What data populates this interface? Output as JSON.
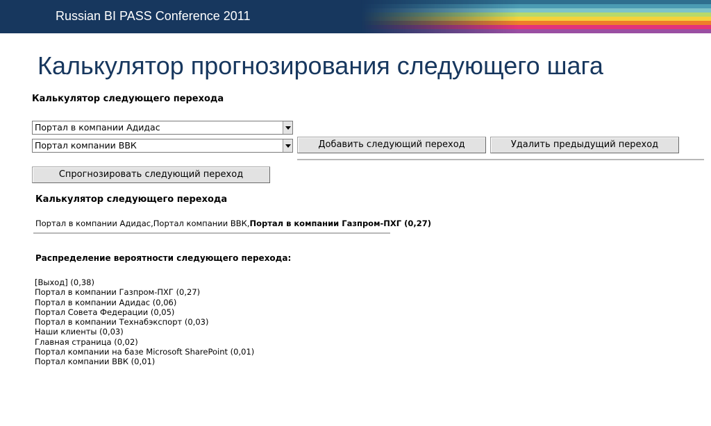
{
  "header": {
    "conference": "Russian BI PASS Conference 2011",
    "stripe_colors": [
      "#2f6f8f",
      "#4b9bb3",
      "#7ec3c8",
      "#b7d96a",
      "#f4d23c",
      "#ef7d2a",
      "#e2337a",
      "#9a4ea2"
    ]
  },
  "slide_title": "Калькулятор прогнозирования следующего шага",
  "calculator": {
    "heading": "Калькулятор следующего перехода",
    "select1_value": "Портал в компании Адидас",
    "select2_value": "Портал компании ВВК",
    "add_button": "Добавить следующий переход",
    "remove_button": "Удалить предыдущий переход",
    "predict_button": "Спрогнозировать следующий переход"
  },
  "result": {
    "title": "Калькулятор следующего перехода",
    "path_prefix": "Портал в компании Адидас,Портал компании ВВК,",
    "path_prediction": "Портал в компании Газпром-ПХГ (0,27)"
  },
  "distribution": {
    "title": "Распределение вероятности следующего перехода:",
    "items": [
      "[Выход] (0,38)",
      "Портал в компании Газпром-ПХГ (0,27)",
      "Портал в компании Адидас (0,06)",
      "Портал Совета Федерации (0,05)",
      "Портал в компании Технабэкспорт (0,03)",
      "Наши клиенты (0,03)",
      "Главная страница (0,02)",
      "Портал компании на базе Microsoft SharePoint (0,01)",
      "Портал компании ВВК (0,01)"
    ]
  }
}
